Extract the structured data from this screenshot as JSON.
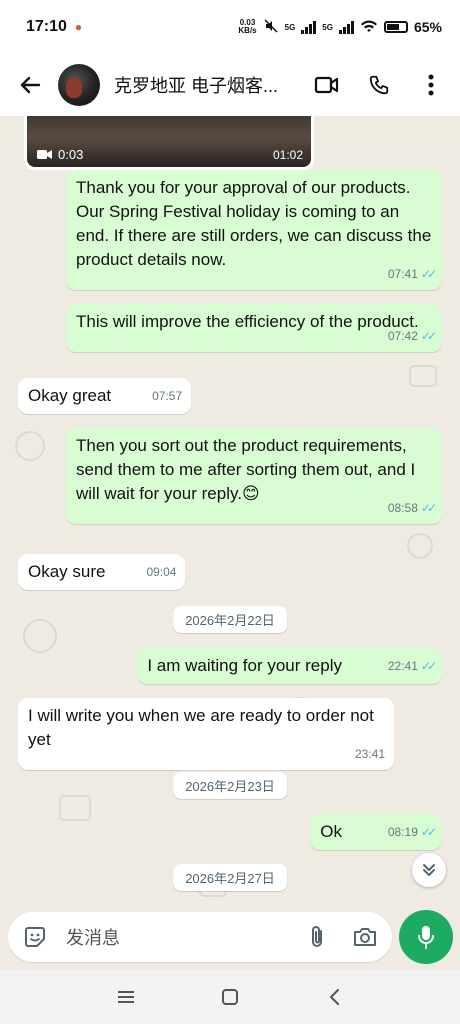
{
  "status_bar": {
    "time": "17:10",
    "network_speed_value": "0.03",
    "network_speed_unit": "KB/s",
    "sim1": "5G",
    "sim2": "5G",
    "battery": "65%"
  },
  "header": {
    "contact_name": "克罗地亚 电子烟客..."
  },
  "video_message": {
    "duration": "0:03",
    "time": "01:02"
  },
  "messages": [
    {
      "dir": "out",
      "text": "Thank you for your approval of our products. Our Spring Festival holiday is coming to an end. If there are still orders, we can discuss the product details now.",
      "time": "07:41"
    },
    {
      "dir": "out",
      "text": "This will improve the efficiency of the product.",
      "time": "07:42"
    },
    {
      "dir": "in",
      "text": "Okay great",
      "time": "07:57"
    },
    {
      "dir": "out",
      "text": "Then you sort out the product requirements, send them to me after sorting them out, and I will wait for your reply.😊",
      "time": "08:58"
    },
    {
      "dir": "in",
      "text": "Okay sure",
      "time": "09:04"
    },
    {
      "dir": "out",
      "text": "I am waiting for your reply",
      "time": "22:41"
    },
    {
      "dir": "in",
      "text": "I will write you when we are ready to order not yet",
      "time": "23:41"
    },
    {
      "dir": "out",
      "text": "Ok",
      "time": "08:19"
    }
  ],
  "dates": [
    "2026年2月22日",
    "2026年2月23日",
    "2026年2月27日"
  ],
  "composer": {
    "placeholder": "发消息"
  },
  "colors": {
    "outgoing_bubble": "#d9fdd3",
    "incoming_bubble": "#ffffff",
    "chat_background": "#efeae2",
    "read_ticks": "#53bdeb",
    "mic_button": "#1daa61"
  }
}
